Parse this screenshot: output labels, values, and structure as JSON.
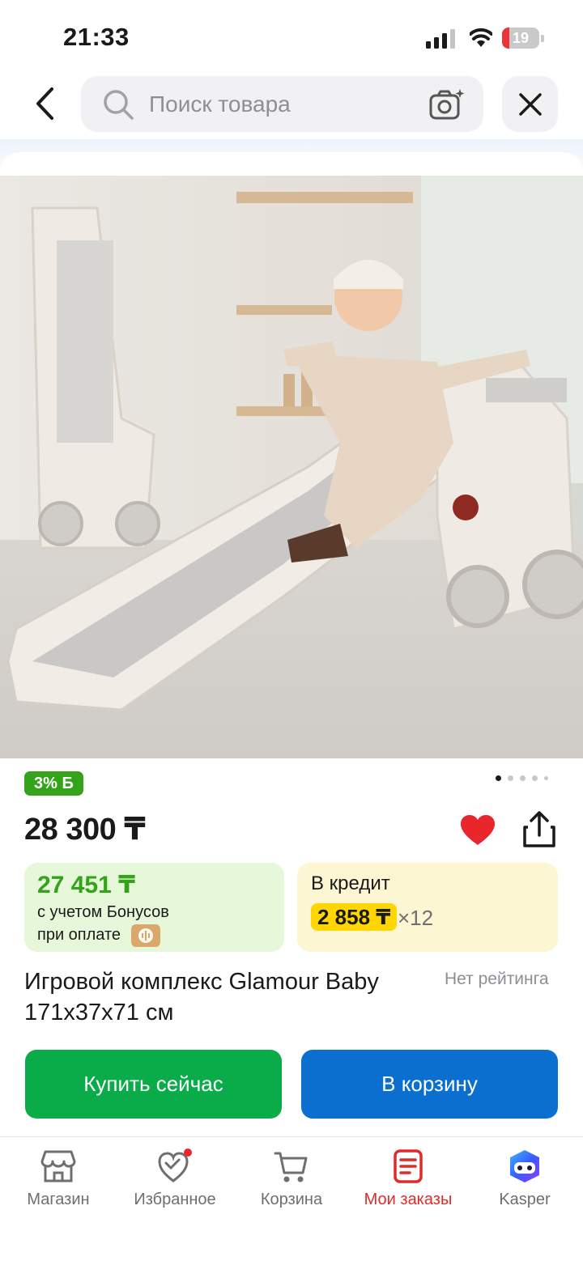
{
  "status_bar": {
    "time": "21:33",
    "battery_level": "19"
  },
  "search": {
    "placeholder": "Поиск товара"
  },
  "product": {
    "bonus_badge": "3% Б",
    "price": "28 300 ₸",
    "title": "Игровой комплекс Glamour Baby 171x37x71 см",
    "rating": "Нет рейтинга",
    "image_pages": 5,
    "image_current_page": 1
  },
  "bonus_offer": {
    "price": "27 451 ₸",
    "line1": "с учетом Бонусов",
    "line2": "при оплате"
  },
  "credit_offer": {
    "title": "В кредит",
    "monthly": "2 858 ₸",
    "months": "×12"
  },
  "actions": {
    "buy_now": "Купить сейчас",
    "add_to_cart": "В корзину"
  },
  "bottom_nav": {
    "items": [
      {
        "label": "Магазин",
        "icon": "store-icon"
      },
      {
        "label": "Избранное",
        "icon": "heart-outline-icon"
      },
      {
        "label": "Корзина",
        "icon": "cart-icon"
      },
      {
        "label": "Мои заказы",
        "icon": "orders-icon"
      },
      {
        "label": "Kasper",
        "icon": "kasper-assistant-icon"
      }
    ],
    "active": "Мои заказы"
  },
  "colors": {
    "buy_now": "#0aab49",
    "add_to_cart": "#0a6fcf",
    "bonus_green": "#34a31a",
    "active_nav": "#e02b2b",
    "credit_badge": "#ffd600"
  }
}
